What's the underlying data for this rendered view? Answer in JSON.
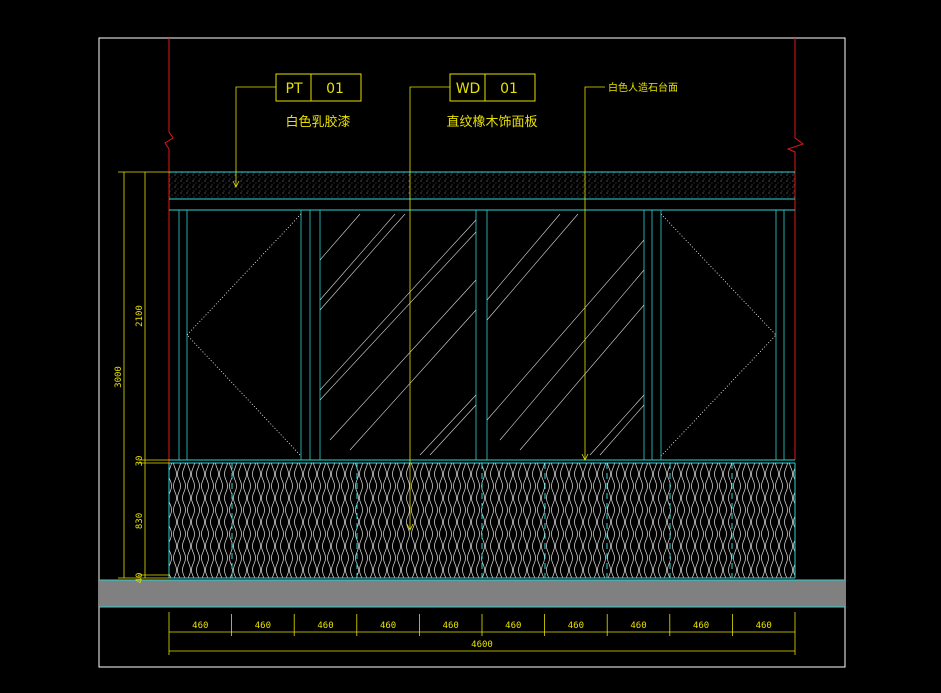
{
  "tags": [
    {
      "code": "PT",
      "num": "01",
      "label": "白色乳胶漆"
    },
    {
      "code": "WD",
      "num": "01",
      "label": "直纹橡木饰面板"
    }
  ],
  "callout_stone": "白色人造石台面",
  "dims_vertical": {
    "total": "3000",
    "upper": "2100",
    "top": "30",
    "lower": "830",
    "base": "40"
  },
  "dims_horizontal": {
    "segments": [
      "460",
      "460",
      "460",
      "460",
      "460",
      "460",
      "460",
      "460",
      "460",
      "460"
    ],
    "total": "4600"
  },
  "colors": {
    "background": "#000000",
    "cyan_lines": "#2fd4d4",
    "red_walls": "#e01818",
    "yellow_annotation": "#e8e000",
    "floor_fill": "#808080"
  }
}
